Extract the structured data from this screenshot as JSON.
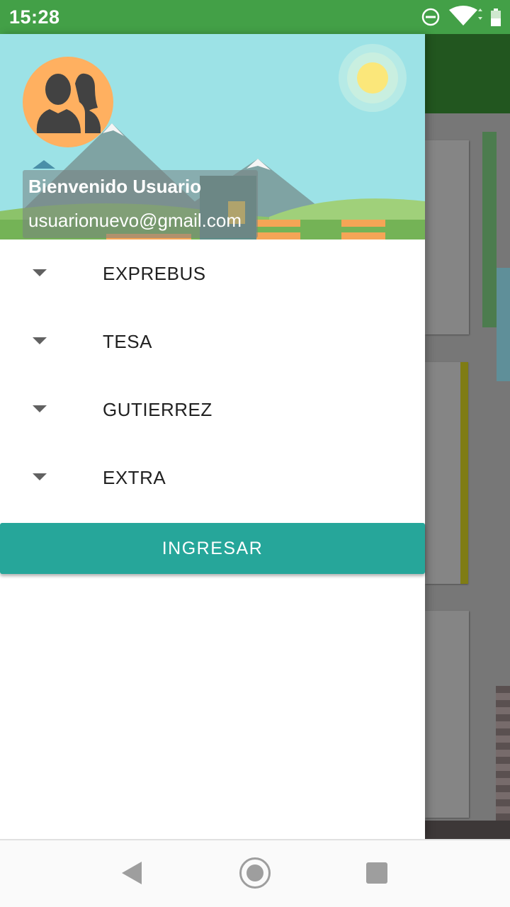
{
  "status_bar": {
    "time": "15:28",
    "icons": [
      "dnd-icon",
      "wifi-icon",
      "battery-icon"
    ]
  },
  "drawer": {
    "header": {
      "greeting": "Bienvenido Usuario",
      "email": "usuarionuevo@gmail.com"
    },
    "menu": [
      {
        "label": "EXPREBUS",
        "icon": "chevron-down-icon"
      },
      {
        "label": "TESA",
        "icon": "chevron-down-icon"
      },
      {
        "label": "GUTIERREZ",
        "icon": "chevron-down-icon"
      },
      {
        "label": "EXTRA",
        "icon": "chevron-down-icon"
      }
    ],
    "button_label": "INGRESAR"
  },
  "nav_bar": {
    "icons": [
      "back-icon",
      "home-icon",
      "recent-apps-icon"
    ]
  },
  "colors": {
    "status_bar": "#43a047",
    "accent": "#26a69a",
    "header_sky": "#9ce2e6",
    "avatar": "#ffb060"
  }
}
